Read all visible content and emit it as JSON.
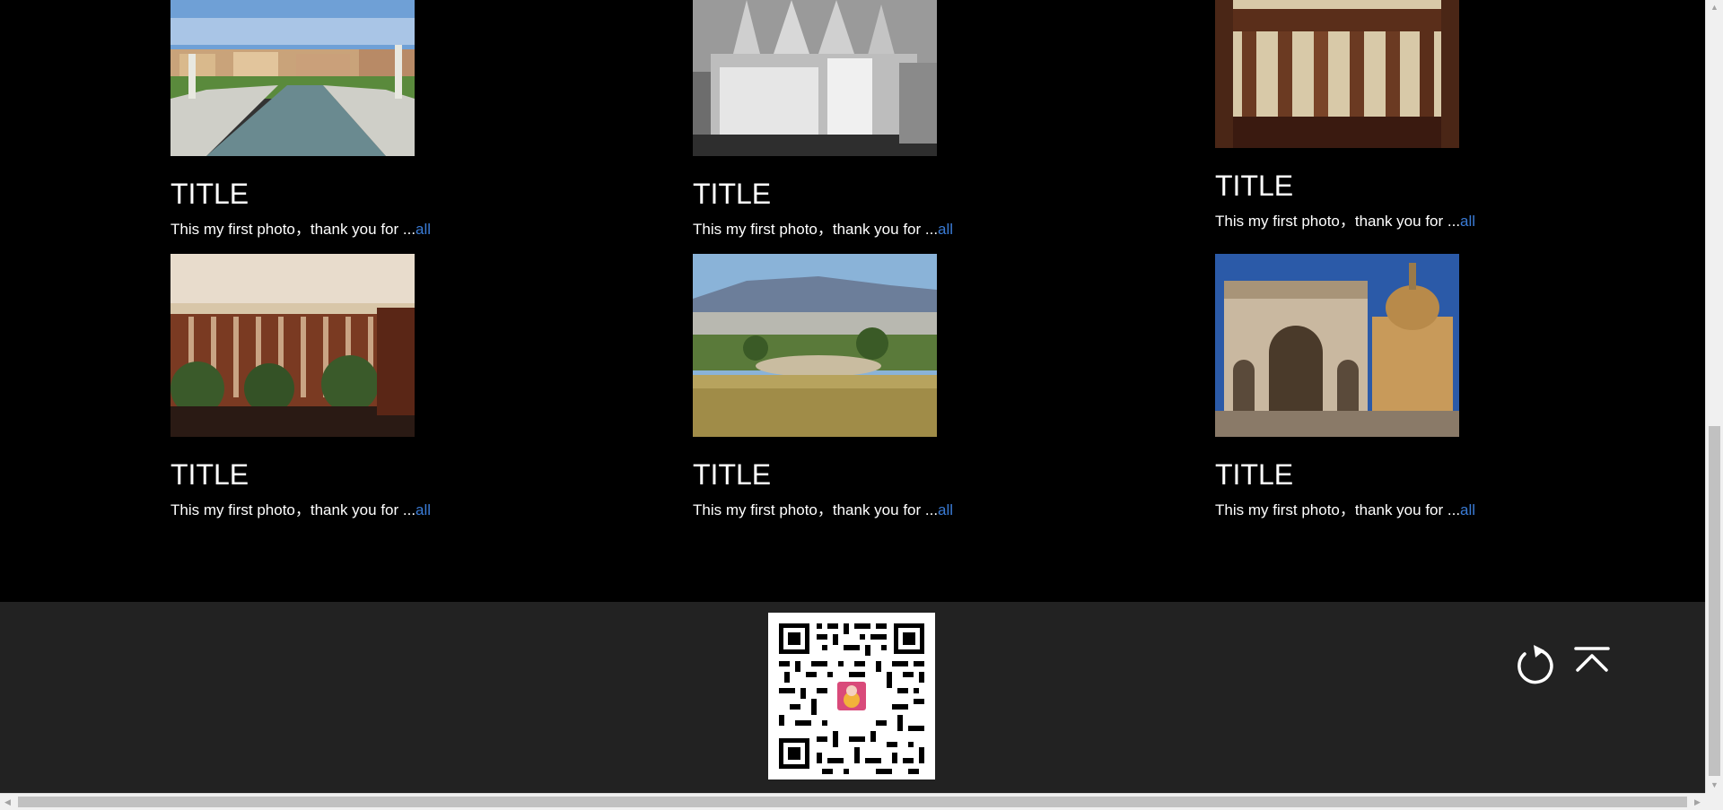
{
  "gallery": {
    "cards": [
      {
        "title": "TITLE",
        "desc": "This my first photo，thank you for ...",
        "more": "all",
        "photo": "canal-with-statues-photo"
      },
      {
        "title": "TITLE",
        "desc": "This my first photo，thank you for ...",
        "more": "all",
        "photo": "gothic-cathedral-photo"
      },
      {
        "title": "TITLE",
        "desc": "This my first photo，thank you for ...",
        "more": "all",
        "photo": "brandenburg-gate-photo"
      },
      {
        "title": "TITLE",
        "desc": "This my first photo，thank you for ...",
        "more": "all",
        "photo": "colonnade-museum-photo"
      },
      {
        "title": "TITLE",
        "desc": "This my first photo，thank you for ...",
        "more": "all",
        "photo": "ancient-theater-landscape-photo"
      },
      {
        "title": "TITLE",
        "desc": "This my first photo，thank you for ...",
        "more": "all",
        "photo": "roman-triumphal-arch-photo"
      }
    ]
  },
  "footer": {
    "qr": "qr-code-image",
    "icons": [
      "refresh-icon",
      "back-to-top-icon"
    ]
  },
  "colors": {
    "page_bg": "#000000",
    "footer_bg": "#222222",
    "text": "#ffffff",
    "link": "#3a7bd5"
  }
}
